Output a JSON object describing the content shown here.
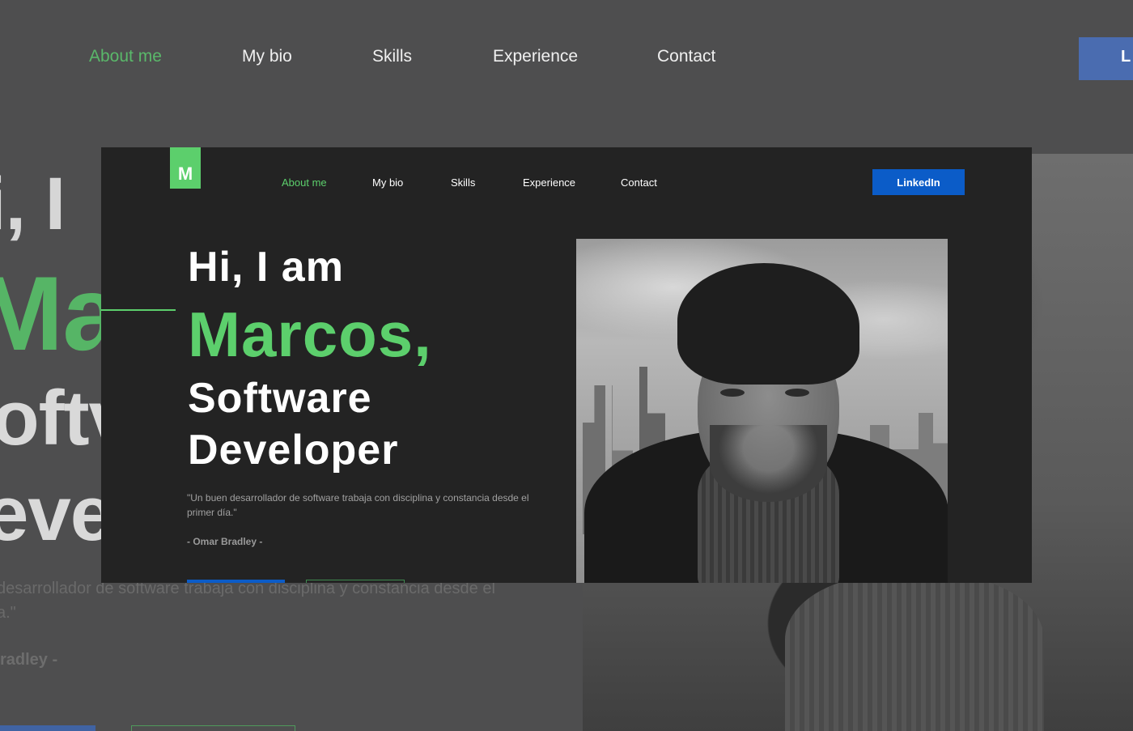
{
  "nav": {
    "items": [
      "About me",
      "My bio",
      "Skills",
      "Experience",
      "Contact"
    ],
    "active_index": 0,
    "linkedin_label": "LinkedIn"
  },
  "background": {
    "linkedin_fragment": "L",
    "hero_fragments": [
      "i, I",
      "Ma",
      "oftv",
      "eve"
    ],
    "quote_fragment_1": " desarrollador de software trabaja con disciplina y constancia desde el",
    "quote_fragment_2": "a.\"",
    "author_fragment": "radley -"
  },
  "logo": {
    "letter": "M"
  },
  "hero": {
    "greeting": "Hi, I am",
    "name": "Marcos,",
    "role_line1": "Software",
    "role_line2": "Developer",
    "quote": "\"Un buen desarrollador de software trabaja con disciplina y constancia desde el primer día.\"",
    "author": "- Omar Bradley -"
  },
  "colors": {
    "accent_green": "#5ccf6c",
    "primary_blue": "#0b5cc8",
    "card_background": "#232323",
    "page_background": "#4e4e4f"
  },
  "icons": {
    "logo": "m-letter-logo",
    "portrait": "profile-photo"
  }
}
